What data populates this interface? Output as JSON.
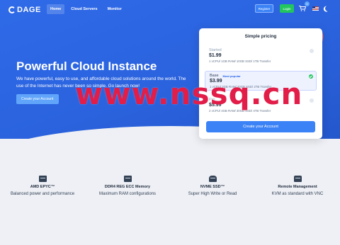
{
  "brand": {
    "name": "DAGE"
  },
  "nav": {
    "items": [
      {
        "label": "Home",
        "active": true
      },
      {
        "label": "Cloud Servers",
        "active": false
      },
      {
        "label": "Monitor",
        "active": false
      }
    ],
    "register_label": "Register",
    "login_label": "Login",
    "cart_count": "0"
  },
  "hero": {
    "title": "Powerful Cloud Instance",
    "description": "We have powerful, easy to use, and affordable cloud solutions around the world. The use of the Internet has never been so simple. Go launch now!",
    "cta_label": "Create your Account"
  },
  "pricing": {
    "title": "Simple pricing",
    "plans": [
      {
        "name": "Started",
        "badge": "",
        "price": "$1.99",
        "specs": "1 vCPU/ 1GB RAM/ 10GB SSD/ 1TB Transfer",
        "selected": false
      },
      {
        "name": "Base",
        "badge": "Most popular",
        "price": "$3.99",
        "specs": "1 vCPU/ 2GB RAM/ 20GB SSD/ 2TB Transfer",
        "selected": true
      },
      {
        "name": "Pro",
        "badge": "",
        "price": "$5.99",
        "specs": "2 vCPU/ 4GB RAM/ 30GB SSD/ 4TB Transfer",
        "selected": false
      }
    ],
    "create_label": "Create your Account"
  },
  "watermark": "www.nssq.cn",
  "features": [
    {
      "icon": "cpu-icon",
      "title": "AMD EPYC™",
      "desc": "Balanced power and performance"
    },
    {
      "icon": "ram-icon",
      "title": "DDR4 REG ECC Memory",
      "desc": "Maximum RAM configurations"
    },
    {
      "icon": "ssd-icon",
      "title": "NVME SSD™",
      "desc": "Super High Write or Read"
    },
    {
      "icon": "server-icon",
      "title": "Remote Management",
      "desc": "KVM as standard with VNC"
    }
  ],
  "colors": {
    "primary": "#2f6ae8",
    "login": "#22c55e",
    "watermark": "#e11d48"
  }
}
